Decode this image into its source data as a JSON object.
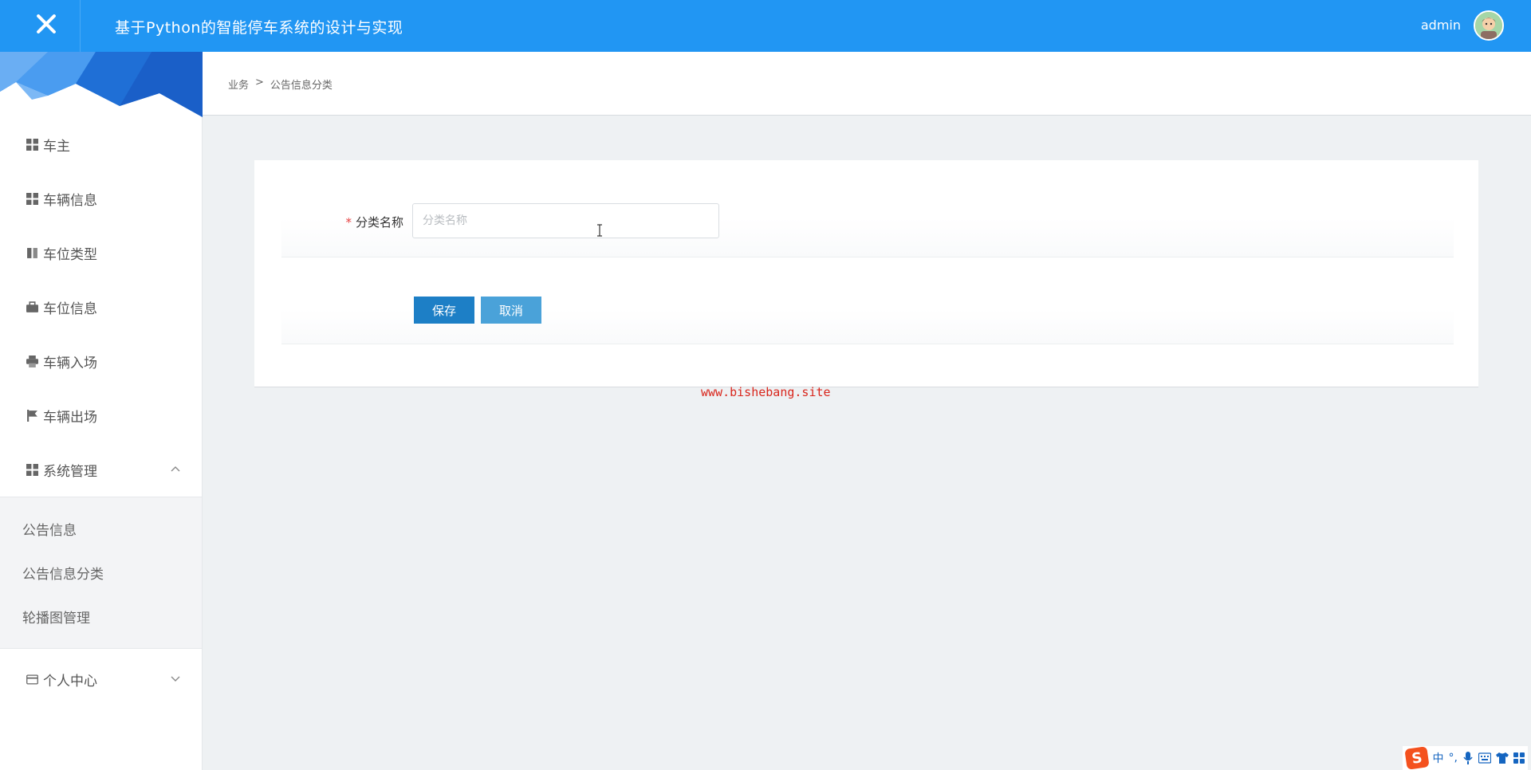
{
  "header": {
    "app_title": "基于Python的智能停车系统的设计与实现",
    "username": "admin"
  },
  "breadcrumb": {
    "root": "业务",
    "separator": ">",
    "current": "公告信息分类"
  },
  "sidebar": {
    "items": [
      {
        "label": "车主",
        "icon": "grid-icon"
      },
      {
        "label": "车辆信息",
        "icon": "grid-icon"
      },
      {
        "label": "车位类型",
        "icon": "book-icon"
      },
      {
        "label": "车位信息",
        "icon": "briefcase-icon"
      },
      {
        "label": "车辆入场",
        "icon": "print-icon"
      },
      {
        "label": "车辆出场",
        "icon": "flag-icon"
      },
      {
        "label": "系统管理",
        "icon": "grid-icon",
        "expanded": true
      }
    ],
    "submenu": [
      {
        "label": "公告信息"
      },
      {
        "label": "公告信息分类"
      },
      {
        "label": "轮播图管理"
      }
    ],
    "footer_item": {
      "label": "个人中心",
      "icon": "credit-card-icon",
      "expanded": false
    }
  },
  "form": {
    "required_mark": "*",
    "category_label": "分类名称",
    "category_value": "",
    "category_placeholder": "分类名称",
    "save_label": "保存",
    "cancel_label": "取消"
  },
  "watermark": "www.bishebang.site",
  "ime": {
    "mode": "中",
    "punct": "°,"
  },
  "colors": {
    "header_bg": "#2196f3",
    "save_button": "#1d7fc6",
    "cancel_button": "#4aa2d9",
    "required": "#e64242",
    "watermark": "#d9261c"
  }
}
